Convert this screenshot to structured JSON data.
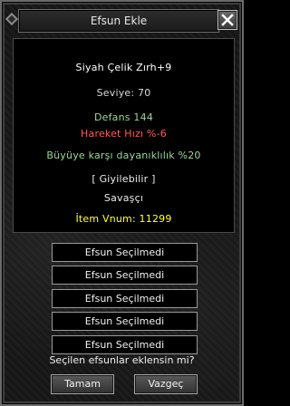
{
  "window": {
    "title": "Efsun Ekle"
  },
  "item": {
    "name": "Siyah Çelik Zırh+9",
    "level": "Seviye: 70",
    "defense": "Defans 144",
    "bonus1": "Hareket Hızı %-6",
    "bonus2": "Büyüye karşı dayanıklılık %20",
    "wearable": "[ Giyilebilir ]",
    "class": "Savaşçı",
    "vnum": "İtem Vnum: 11299"
  },
  "slots": [
    "Efsun Seçilmedi",
    "Efsun Seçilmedi",
    "Efsun Seçilmedi",
    "Efsun Seçilmedi",
    "Efsun Seçilmedi"
  ],
  "prompt": "Seçilen efsunlar eklensin mi?",
  "buttons": {
    "ok": "Tamam",
    "cancel": "Vazgeç"
  },
  "colors": {
    "name": "#ffffff",
    "level": "#d9d9d9",
    "defense": "#9fd39f",
    "bonus1": "#ff5c5c",
    "bonus2": "#9fd39f",
    "vnum": "#ffff3a"
  },
  "icons": {
    "close": "close-x-icon"
  }
}
